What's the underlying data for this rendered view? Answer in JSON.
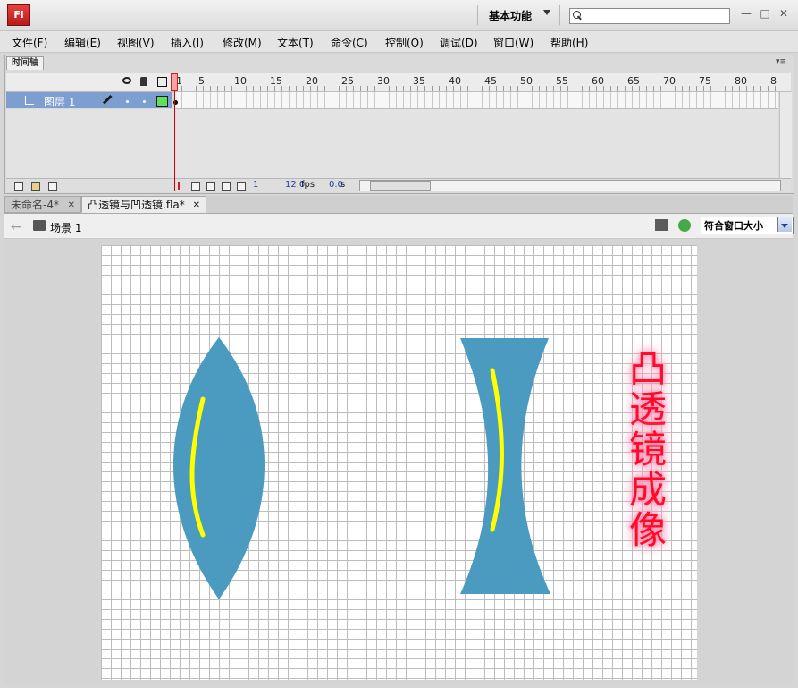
{
  "titlebar": {
    "app_icon": "Fl",
    "workspace": "基本功能",
    "window_controls": [
      "—",
      "□",
      "✕"
    ]
  },
  "menu": [
    "文件(F)",
    "编辑(E)",
    "视图(V)",
    "插入(I)",
    "修改(M)",
    "文本(T)",
    "命令(C)",
    "控制(O)",
    "调试(D)",
    "窗口(W)",
    "帮助(H)"
  ],
  "timeline": {
    "tab_label": "时间轴",
    "menu_glyph": "▾≡",
    "frame_ticks": [
      "1",
      "5",
      "10",
      "15",
      "20",
      "25",
      "30",
      "35",
      "40",
      "45",
      "50",
      "55",
      "60",
      "65",
      "70",
      "75",
      "80",
      "8"
    ],
    "layer": {
      "name": "图层 1",
      "color": "#5fe05f"
    },
    "current_frame": "1",
    "fps": "12.0",
    "fps_unit": "fps",
    "elapsed": "0.0",
    "elapsed_unit": "s"
  },
  "doc_tabs": [
    {
      "label": "未命名-4*",
      "close": "✕",
      "active": false
    },
    {
      "label": "凸透镜与凹透镜.fla*",
      "close": "✕",
      "active": true
    }
  ],
  "edit_bar": {
    "scene_label": "场景 1",
    "zoom": "符合窗口大小"
  },
  "stage": {
    "lens_color": "#4b9abf",
    "highlight_color": "#ffff00",
    "text_color": "#ff0a2a",
    "vertical_text": [
      "凸",
      "透",
      "镜",
      "成",
      "像"
    ]
  }
}
